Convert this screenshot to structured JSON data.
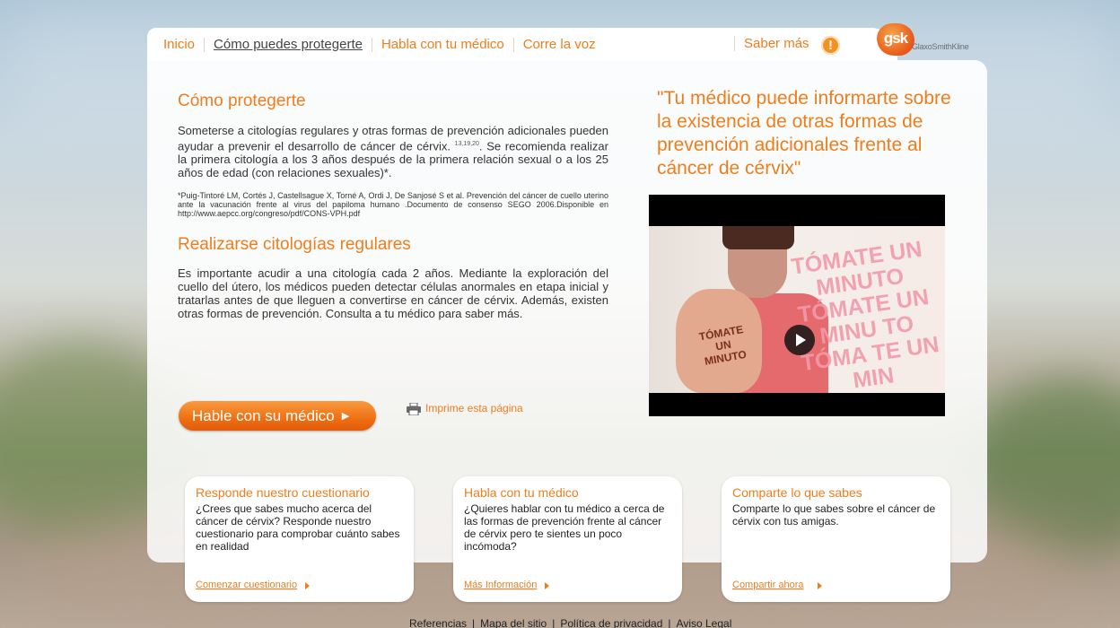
{
  "nav": {
    "items": [
      "Inicio",
      "Cómo puedes protegerte",
      "Habla con tu médico",
      "Corre la voz"
    ],
    "active_index": 1,
    "more_label": "Saber más",
    "warning_icon": "exclamation-icon",
    "logo_mark": "gsk",
    "logo_text": "GlaxoSmithKline"
  },
  "main": {
    "section1": {
      "heading": "Cómo protegerte",
      "text_before_sup": "Someterse a citologías regulares y otras formas de prevención adicionales pueden ayudar a prevenir el desarrollo de cáncer de cérvix.",
      "sup": "13,19,20",
      "text_after_sup": ". Se recomienda realizar la primera citología a los 3 años después de la primera relación sexual o a los 25 años de edad (con relaciones sexuales)*.",
      "footnote": "*Puig-Tintoré LM, Cortés J, Castellsague X, Torné A, Ordi J, De Sanjosé S et al. Prevención del cáncer de cuello uterino ante la vacunación frente al virus del papiloma humano .Documento de consenso SEGO 2006.Disponible en http://www.aepcc.org/congreso/pdf/CONS-VPH.pdf"
    },
    "section2": {
      "heading": "Realizarse citologías regulares",
      "text": "Es importante acudir a una citología cada 2 años. Mediante la exploración del cuello del útero, los médicos pueden detectar células anormales en etapa inicial y tratarlas antes de que lleguen a convertirse en cáncer de cérvix. Además, existen otras formas de prevención. Consulta a tu médico para saber más."
    },
    "cta_label": "Hable con su médico",
    "print_label": "Imprime esta página",
    "quote": "\"Tu médico puede informarte sobre la existencia de otras formas de prevención adicionales frente al cáncer de cérvix\"",
    "video": {
      "overlay_text": "TÓMATE UN MINUTO TÓMATE UN MINU TO TÓMA TE UN MIN",
      "hand_text": "TÓMATE UN MINUTO"
    }
  },
  "cards": [
    {
      "title": "Responde nuestro cuestionario",
      "text": "¿Crees que sabes mucho acerca del cáncer de cérvix? Responde nuestro cuestionario para comprobar cuánto sabes en realidad",
      "link": "Comenzar cuestionario"
    },
    {
      "title": "Habla con tu médico",
      "text": "¿Quieres hablar con tu médico a cerca de las formas de prevención frente al cáncer de cérvix pero te sientes un poco incómoda?",
      "link": "Más Información"
    },
    {
      "title": "Comparte lo que sabes",
      "text": "Comparte lo que sabes sobre el cáncer de cérvix con tus amigas.",
      "link": "Compartir ahora"
    }
  ],
  "footer": [
    "Referencias",
    "Mapa del sitio",
    "Política de privacidad",
    "Aviso Legal"
  ]
}
